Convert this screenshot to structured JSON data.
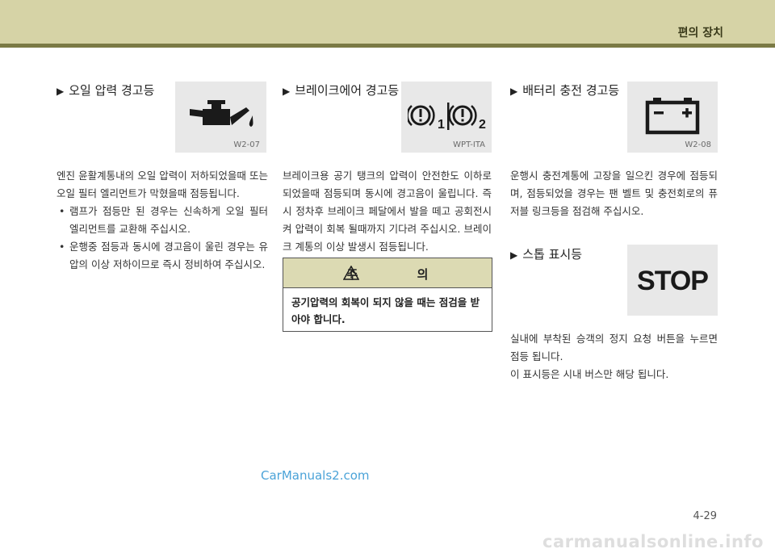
{
  "header": {
    "title": "편의 장치"
  },
  "sections": {
    "oil": {
      "title": "오일 압력 경고등",
      "code": "W2-07",
      "icon": "oil-can-icon",
      "body": "엔진 윤활계통내의 오일 압력이 저하되었을때 또는 오일 필터 엘리먼트가 막혔을때 점등됩니다.",
      "bullets": [
        "램프가 점등만 된 경우는 신속하게 오일 필터 엘리먼트를 교환해 주십시오.",
        "운행중 점등과 동시에 경고음이 울린 경우는 유압의 이상 저하이므로 즉시 정비하여 주십시오."
      ]
    },
    "brake": {
      "title": "브레이크에어 경고등",
      "code": "WPT-ITA",
      "icon": "brake-warning-icon",
      "icon_num1": "1",
      "icon_num2": "2",
      "body": "브레이크용 공기 탱크의 압력이 안전한도 이하로 되었을때 점등되며 동시에 경고음이 울립니다. 즉시 정차후 브레이크 페달에서 발을 떼고 공회전시켜 압력이 회복 될때까지 기다려 주십시오. 브레이크 계통의 이상 발생시 점등됩니다."
    },
    "caution": {
      "title": "주 의",
      "body": "공기압력의 회복이 되지 않을 때는 점검을 받아야 합니다."
    },
    "battery": {
      "title": "배터리 충전 경고등",
      "code": "W2-08",
      "icon": "battery-icon",
      "body": "운행시 충전계통에 고장을 일으킨 경우에 점등되며, 점등되었을 경우는 팬 벨트 및 충전회로의 퓨저블 링크등을 점검해 주십시오."
    },
    "stop": {
      "title": "스톱 표시등",
      "icon_text": "STOP",
      "body1": "실내에 부착된 승객의 정지 요청 버튼을 누르면 점등 됩니다.",
      "body2": "이 표시등은 시내 버스만 해당 됩니다."
    }
  },
  "watermark": "CarManuals2.com",
  "page_number": "4-29",
  "footer_watermark": "carmanualsonline.info"
}
